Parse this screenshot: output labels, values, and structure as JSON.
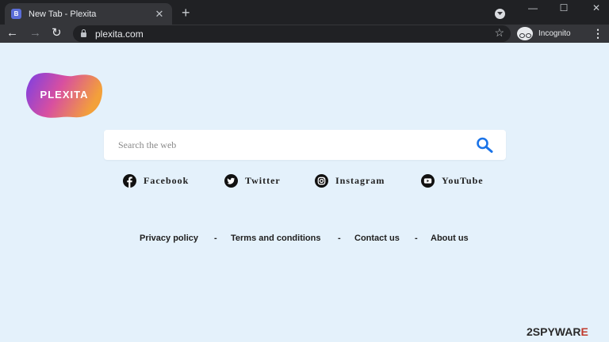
{
  "browser": {
    "tab": {
      "favicon_letter": "B",
      "title": "New Tab - Plexita",
      "close_glyph": "✕"
    },
    "new_tab_glyph": "+",
    "window_controls": {
      "minimize": "—",
      "maximize": "☐",
      "close": "✕"
    },
    "toolbar": {
      "back": "←",
      "forward": "→",
      "reload": "↻",
      "url": "plexita.com",
      "bookmark": "☆",
      "profile_label": "Incognito",
      "menu": "⋮"
    }
  },
  "page": {
    "logo": {
      "text": "PLEXITA"
    },
    "search": {
      "placeholder": "Search the web",
      "value": ""
    },
    "social": [
      {
        "label": "Facebook",
        "icon": "facebook-icon"
      },
      {
        "label": "Twitter",
        "icon": "twitter-icon"
      },
      {
        "label": "Instagram",
        "icon": "instagram-icon"
      },
      {
        "label": "YouTube",
        "icon": "youtube-icon"
      }
    ],
    "footer": {
      "links": [
        "Privacy policy",
        "Terms and conditions",
        "Contact us",
        "About us"
      ],
      "separator": "-"
    }
  },
  "watermark": {
    "prefix": "2SPYWAR",
    "suffix": "E"
  },
  "colors": {
    "page_bg": "#e4f1fb",
    "search_icon": "#1a73e8",
    "tab_bar": "#202124",
    "toolbar": "#35363a"
  }
}
